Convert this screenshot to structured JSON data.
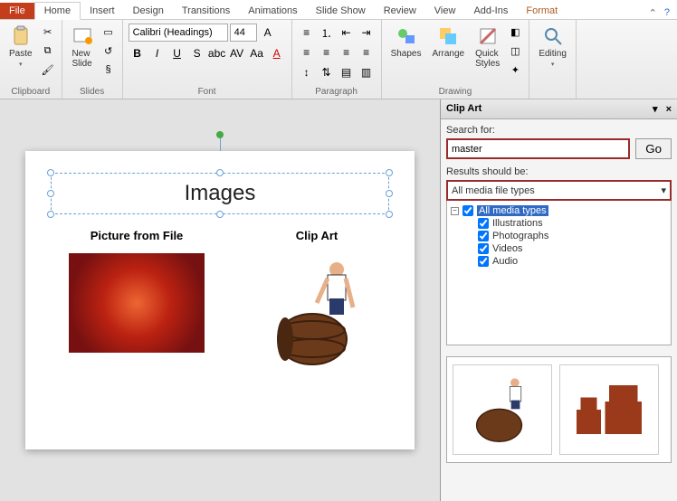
{
  "tabs": {
    "file": "File",
    "home": "Home",
    "insert": "Insert",
    "design": "Design",
    "transitions": "Transitions",
    "animations": "Animations",
    "slideshow": "Slide Show",
    "review": "Review",
    "view": "View",
    "addins": "Add-Ins",
    "format": "Format"
  },
  "ribbon": {
    "clipboard": {
      "label": "Clipboard",
      "paste": "Paste"
    },
    "slides": {
      "label": "Slides",
      "new_slide": "New\nSlide"
    },
    "font": {
      "label": "Font",
      "name": "Calibri (Headings)",
      "size": "44"
    },
    "paragraph": {
      "label": "Paragraph"
    },
    "drawing": {
      "label": "Drawing",
      "shapes": "Shapes",
      "arrange": "Arrange",
      "quick": "Quick\nStyles"
    },
    "editing": {
      "label": "Editing"
    }
  },
  "slide": {
    "title": "Images",
    "col1_heading": "Picture from File",
    "col2_heading": "Clip Art"
  },
  "pane": {
    "title": "Clip Art",
    "search_label": "Search for:",
    "search_value": "master",
    "go": "Go",
    "results_label": "Results should be:",
    "results_value": "All media file types",
    "tree": {
      "root": "All media types",
      "items": [
        "Illustrations",
        "Photographs",
        "Videos",
        "Audio"
      ]
    }
  }
}
